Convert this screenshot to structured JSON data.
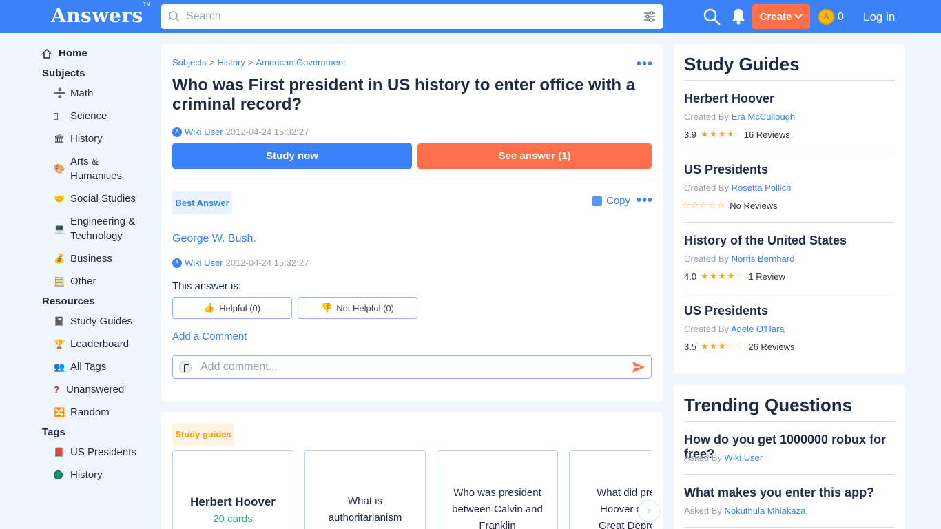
{
  "header": {
    "logo": "Answers",
    "logo_tm": "TM",
    "search_placeholder": "Search",
    "create_label": "Create",
    "coin_count": "0",
    "login_label": "Log in"
  },
  "sidebar": {
    "home": "Home",
    "subjects_heading": "Subjects",
    "subjects": [
      "Math",
      "Science",
      "History",
      "Arts &",
      "Humanities",
      "Social Studies",
      "Engineering &",
      "Technology",
      "Business",
      "Other"
    ],
    "resources_heading": "Resources",
    "resources": [
      "Study Guides",
      "Leaderboard",
      "All Tags",
      "Unanswered",
      "Random"
    ],
    "tags_heading": "Tags",
    "tags": [
      "US Presidents",
      "History"
    ]
  },
  "question": {
    "breadcrumb": [
      "Subjects",
      "History",
      "American Government"
    ],
    "breadcrumb_sep": ">",
    "title": "Who was First president in US history to enter office with a criminal record?",
    "author": "Wiki User",
    "date": "2012-04-24 15:32:27",
    "study_now": "Study now",
    "see_answer": "See answer (1)"
  },
  "answer": {
    "badge": "Best Answer",
    "copy_label": "Copy",
    "text": "George W. Bush.",
    "author": "Wiki User",
    "date": "2012-04-24 15:32:27",
    "answer_is": "This answer is:",
    "helpful": "Helpful (0)",
    "not_helpful": "Not Helpful (0)",
    "add_comment": "Add a Comment",
    "comment_placeholder": "Add comment..."
  },
  "study_guides_strip": {
    "badge": "Study guides",
    "tiles": [
      {
        "line1": "Herbert Hoover",
        "line2": "20 cards"
      },
      {
        "line1": "What is",
        "line2": "authoritarianism"
      },
      {
        "line1": "Who was president",
        "line2": "between Calvin and",
        "line3": "Franklin"
      },
      {
        "line1": "What did presi",
        "line2": "Hoover do to",
        "line3": "Great Depres"
      }
    ]
  },
  "right": {
    "study_guides_title": "Study Guides",
    "created_by": "Created By",
    "guides": [
      {
        "name": "Herbert Hoover",
        "author": "Era McCullough",
        "rating": "3.9",
        "stars": 3.5,
        "reviews": "16 Reviews"
      },
      {
        "name": "US Presidents",
        "author": "Rosetta Pollich",
        "rating": "",
        "stars": 0,
        "reviews": "No Reviews"
      },
      {
        "name": "History of the United States",
        "author": "Norris Bernhard",
        "rating": "4.0",
        "stars": 4,
        "reviews": "1 Review"
      },
      {
        "name": "US Presidents",
        "author": "Adele O'Hara",
        "rating": "3.5",
        "stars": 3,
        "reviews": "26 Reviews"
      }
    ],
    "trending_title": "Trending Questions",
    "asked_by": "Asked By",
    "trending": [
      {
        "q": "How do you get 1000000 robux for free?",
        "author": "Wiki User"
      },
      {
        "q": "What makes you enter this app?",
        "author": "Nokuthula Mhlakaza"
      }
    ]
  }
}
